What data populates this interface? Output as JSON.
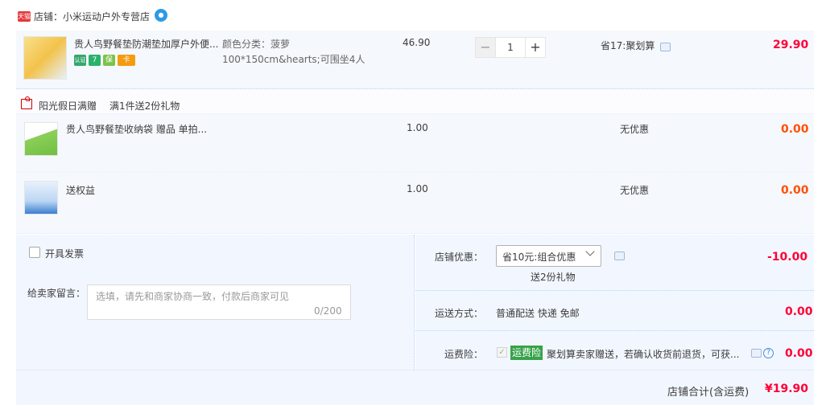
{
  "shop": {
    "badge": "天猫",
    "label": "店铺：小米运动户外专营店",
    "ww_icon": "ww"
  },
  "main_item": {
    "title": "贵人鸟野餐垫防潮垫加厚户外便...",
    "badges": [
      {
        "icon": "auth-icon",
        "text": "认证",
        "color": "#36a76e"
      },
      {
        "icon": "seven-day-icon",
        "text": "7",
        "color": "#29b36a"
      },
      {
        "icon": "guarantee-icon",
        "text": "保",
        "color": "#7cc247"
      },
      {
        "icon": "card-icon",
        "text": "卡",
        "color": "#f39c12"
      }
    ],
    "sku": "颜色分类：菠萝100*150cm&hearts;可围坐4人",
    "price": "46.90",
    "qty_minus": "−",
    "qty_value": "1",
    "qty_plus": "+",
    "discount": "省17:聚划算",
    "subtotal": "29.90"
  },
  "gift_header": {
    "label": "阳光假日满赠",
    "desc": "满1件送2份礼物"
  },
  "gift_items": [
    {
      "title": "贵人鸟野餐垫收纳袋 赠品 单拍...",
      "price": "1.00",
      "discount": "无优惠",
      "subtotal": "0.00"
    },
    {
      "title": "送权益",
      "price": "1.00",
      "discount": "无优惠",
      "subtotal": "0.00"
    }
  ],
  "invoice": {
    "label": "开具发票"
  },
  "message": {
    "label": "给卖家留言：",
    "placeholder": "选填，请先和商家协商一致，付款后商家可见",
    "count": "0/200"
  },
  "promo": {
    "label": "店铺优惠：",
    "selected": "省10元:组合优惠",
    "note": "送2份礼物",
    "amount": "-10.00"
  },
  "shipping": {
    "label": "运送方式：",
    "value": "普通配送 快递 免邮",
    "amount": "0.00"
  },
  "insurance": {
    "label": "运费险：",
    "tag": "运费险",
    "desc": "聚划算卖家赠送，若确认收货前退货，可获...",
    "amount": "0.00"
  },
  "total": {
    "label": "店铺合计(含运费)",
    "amount": "¥19.90"
  }
}
